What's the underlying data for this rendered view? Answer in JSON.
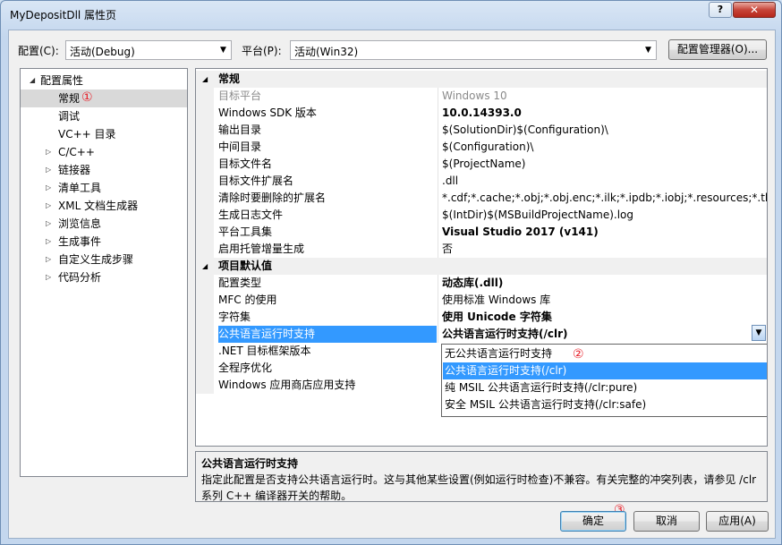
{
  "window": {
    "title": "MyDepositDll 属性页",
    "help_glyph": "?",
    "close_glyph": "✕"
  },
  "top": {
    "config_label": "配置(C):",
    "config_value": "活动(Debug)",
    "platform_label": "平台(P):",
    "platform_value": "活动(Win32)",
    "manager_button": "配置管理器(O)..."
  },
  "tree": {
    "items": [
      {
        "label": "配置属性",
        "twisty": "◢",
        "level": 0
      },
      {
        "label": "常规",
        "twisty": "",
        "level": 1,
        "selected": true
      },
      {
        "label": "调试",
        "twisty": "",
        "level": 1
      },
      {
        "label": "VC++ 目录",
        "twisty": "",
        "level": 1
      },
      {
        "label": "C/C++",
        "twisty": "▷",
        "level": 1
      },
      {
        "label": "链接器",
        "twisty": "▷",
        "level": 1
      },
      {
        "label": "清单工具",
        "twisty": "▷",
        "level": 1
      },
      {
        "label": "XML 文档生成器",
        "twisty": "▷",
        "level": 1
      },
      {
        "label": "浏览信息",
        "twisty": "▷",
        "level": 1
      },
      {
        "label": "生成事件",
        "twisty": "▷",
        "level": 1
      },
      {
        "label": "自定义生成步骤",
        "twisty": "▷",
        "level": 1
      },
      {
        "label": "代码分析",
        "twisty": "▷",
        "level": 1
      }
    ]
  },
  "grid": {
    "categories": [
      {
        "name": "常规",
        "twisty": "◢"
      },
      {
        "name": "项目默认值",
        "twisty": "◢"
      }
    ],
    "general_rows": [
      {
        "name": "目标平台",
        "value": "Windows 10",
        "style": "dim"
      },
      {
        "name": "Windows SDK 版本",
        "value": "10.0.14393.0",
        "style": "bold"
      },
      {
        "name": "输出目录",
        "value": "$(SolutionDir)$(Configuration)\\",
        "style": ""
      },
      {
        "name": "中间目录",
        "value": "$(Configuration)\\",
        "style": ""
      },
      {
        "name": "目标文件名",
        "value": "$(ProjectName)",
        "style": ""
      },
      {
        "name": "目标文件扩展名",
        "value": ".dll",
        "style": ""
      },
      {
        "name": "清除时要删除的扩展名",
        "value": "*.cdf;*.cache;*.obj;*.obj.enc;*.ilk;*.ipdb;*.iobj;*.resources;*.tlb;*.tli;*",
        "style": ""
      },
      {
        "name": "生成日志文件",
        "value": "$(IntDir)$(MSBuildProjectName).log",
        "style": ""
      },
      {
        "name": "平台工具集",
        "value": "Visual Studio 2017 (v141)",
        "style": "bold"
      },
      {
        "name": "启用托管增量生成",
        "value": "否",
        "style": ""
      }
    ],
    "default_rows": [
      {
        "name": "配置类型",
        "value": "动态库(.dll)",
        "style": "bold"
      },
      {
        "name": "MFC 的使用",
        "value": "使用标准 Windows 库",
        "style": ""
      },
      {
        "name": "字符集",
        "value": "使用 Unicode 字符集",
        "style": "bold"
      },
      {
        "name": "公共语言运行时支持",
        "value": "公共语言运行时支持(/clr)",
        "style": "bold"
      },
      {
        "name": ".NET 目标框架版本",
        "value": "",
        "style": ""
      },
      {
        "name": "全程序优化",
        "value": "",
        "style": ""
      },
      {
        "name": "Windows 应用商店应用支持",
        "value": "",
        "style": ""
      }
    ],
    "dropdown_options": [
      "无公共语言运行时支持",
      "公共语言运行时支持(/clr)",
      "纯 MSIL 公共语言运行时支持(/clr:pure)",
      "安全 MSIL 公共语言运行时支持(/clr:safe)"
    ],
    "dropdown_highlighted": 1
  },
  "description": {
    "title": "公共语言运行时支持",
    "text": "指定此配置是否支持公共语言运行时。这与其他某些设置(例如运行时检查)不兼容。有关完整的冲突列表，请参见 /clr 系列 C++ 编译器开关的帮助。"
  },
  "buttons": {
    "ok": "确定",
    "cancel": "取消",
    "apply": "应用(A)"
  },
  "markers": [
    "①",
    "②",
    "③"
  ],
  "colors": {
    "selection": "#3399ff",
    "marker": "#e8202a"
  }
}
